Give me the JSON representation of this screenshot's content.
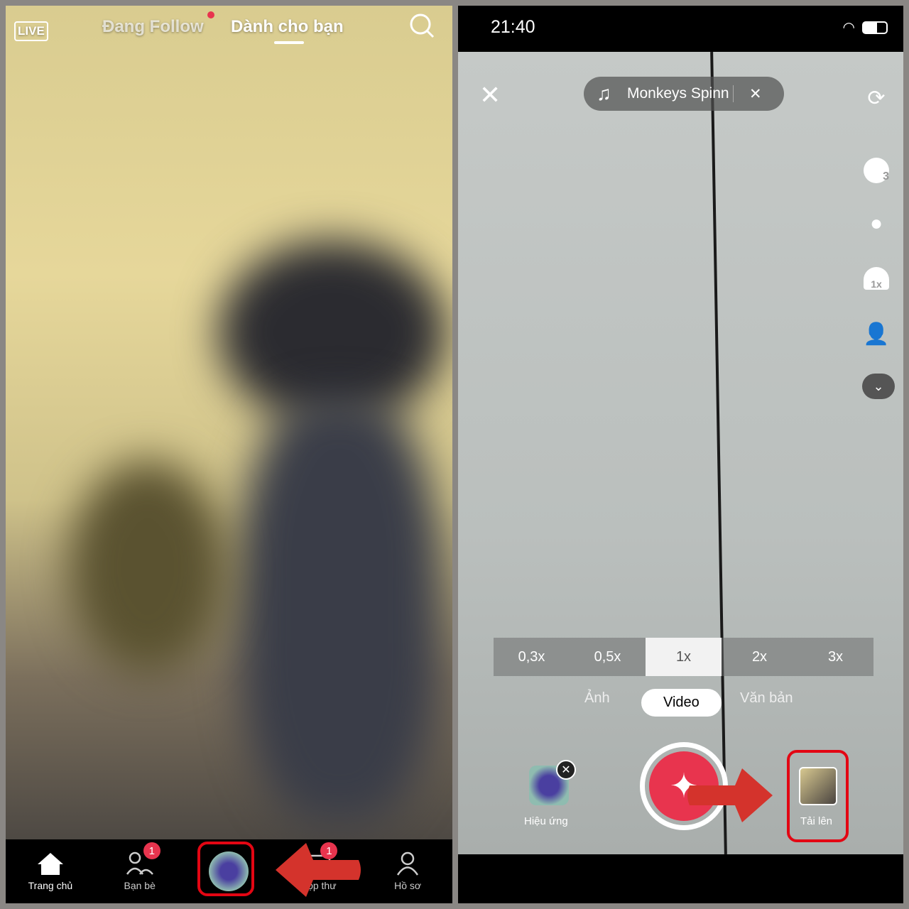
{
  "left": {
    "live_label": "LIVE",
    "tab_following": "Đang Follow",
    "tab_foryou": "Dành cho bạn",
    "nav": [
      {
        "label": "Trang chủ",
        "icon": "home-icon"
      },
      {
        "label": "Bạn bè",
        "icon": "friends-icon",
        "badge": "1"
      },
      {
        "label": "",
        "icon": "create-effect-icon"
      },
      {
        "label": "Hộp thư",
        "icon": "inbox-icon",
        "badge": "1"
      },
      {
        "label": "Hồ sơ",
        "icon": "profile-icon"
      }
    ]
  },
  "right": {
    "time": "21:40",
    "sound": "Monkeys Spinn",
    "zooms": [
      "0,3x",
      "0,5x",
      "1x",
      "2x",
      "3x"
    ],
    "selected_zoom": "1x",
    "modes": [
      "Ảnh",
      "Video",
      "Văn bản"
    ],
    "selected_mode": "Video",
    "effects_label": "Hiệu ứng",
    "upload_label": "Tải lên",
    "timer_value": "3",
    "speed_value": "1x"
  },
  "colors": {
    "accent": "#e8344e",
    "highlight": "#e30613",
    "arrow": "#d4332c"
  }
}
